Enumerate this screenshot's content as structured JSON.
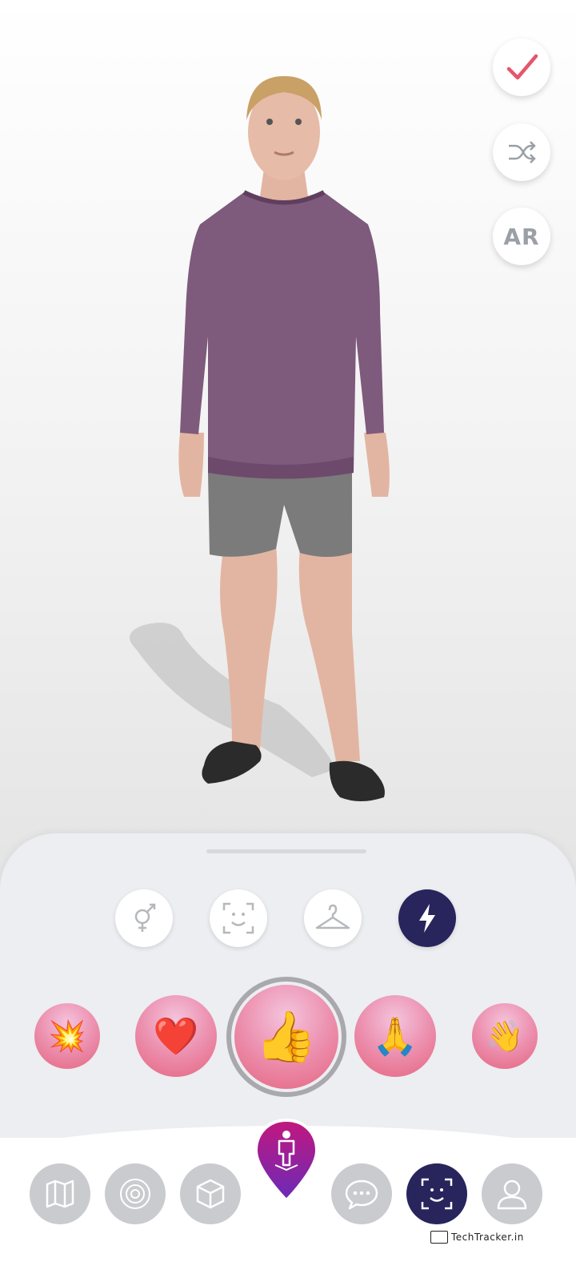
{
  "top_actions": {
    "confirm": {
      "icon": "checkmark-icon",
      "color": "#e4566c"
    },
    "shuffle": {
      "icon": "shuffle-icon"
    },
    "ar": {
      "label": "AR"
    }
  },
  "categories": [
    {
      "name": "gender",
      "icon": "gender-icon",
      "active": false
    },
    {
      "name": "face",
      "icon": "face-scan-icon",
      "active": false
    },
    {
      "name": "clothing",
      "icon": "hanger-icon",
      "active": false
    },
    {
      "name": "actions",
      "icon": "lightning-icon",
      "active": true
    }
  ],
  "reactions": [
    {
      "name": "boom",
      "emoji": "💥"
    },
    {
      "name": "heart",
      "emoji": "❤️"
    },
    {
      "name": "thumbs-up",
      "emoji": "👍",
      "selected": true
    },
    {
      "name": "pray",
      "emoji": "🙏"
    },
    {
      "name": "wave",
      "emoji": "👋"
    }
  ],
  "nav": [
    {
      "name": "map",
      "icon": "map-icon"
    },
    {
      "name": "radar",
      "icon": "radar-icon"
    },
    {
      "name": "cube",
      "icon": "cube-icon"
    },
    {
      "name": "avatar",
      "icon": "avatar-pin-icon",
      "center": true
    },
    {
      "name": "chat",
      "icon": "chat-icon"
    },
    {
      "name": "face-scan",
      "icon": "face-scan-icon",
      "active": true
    },
    {
      "name": "profile",
      "icon": "profile-icon"
    }
  ],
  "colors": {
    "accent_dark": "#28245c",
    "pin_top": "#c2177e",
    "pin_bottom": "#6a2bb8",
    "sweater": "#7e5a7c"
  },
  "watermark": "TechTracker.in"
}
